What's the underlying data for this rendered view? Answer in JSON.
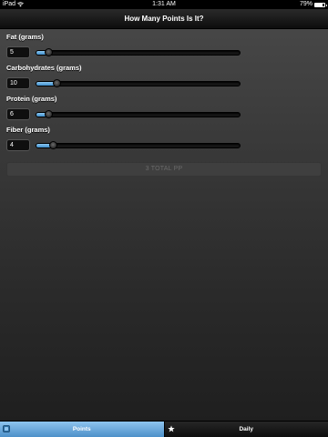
{
  "status_bar": {
    "carrier": "iPad",
    "time": "1:31 AM",
    "battery": "79%",
    "icons": [
      "wifi-icon",
      "battery-icon"
    ],
    "battery_level": 0.79
  },
  "nav": {
    "title": "How Many Points Is It?"
  },
  "fields": [
    {
      "label": "Fat (grams)",
      "value": "5",
      "slider_fraction": 0.06
    },
    {
      "label": "Carbohydrates (grams)",
      "value": "10",
      "slider_fraction": 0.1
    },
    {
      "label": "Protein (grams)",
      "value": "6",
      "slider_fraction": 0.06
    },
    {
      "label": "Fiber (grams)",
      "value": "4",
      "slider_fraction": 0.08
    }
  ],
  "total_button": {
    "label": "3 TOTAL PP"
  },
  "tabs": [
    {
      "label": "Points",
      "icon": "points-icon",
      "active": true
    },
    {
      "label": "Daily",
      "icon": "star-icon",
      "active": false
    }
  ],
  "colors": {
    "accent": "#5a9fd6",
    "background": "#3a3a3a",
    "bar": "#000000"
  }
}
